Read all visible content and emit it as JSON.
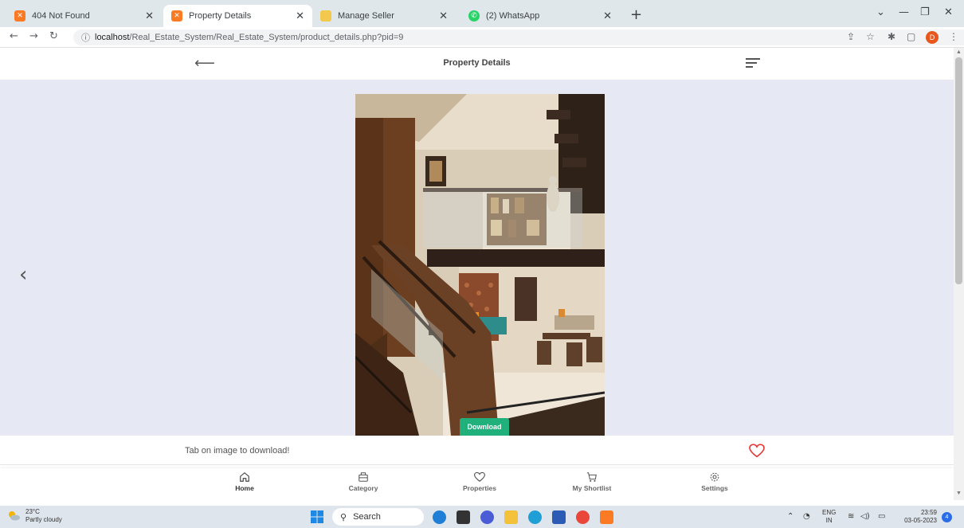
{
  "browser": {
    "tabs": [
      {
        "label": "404 Not Found",
        "icon": "xampp-icon",
        "active": false
      },
      {
        "label": "Property Details",
        "icon": "xampp-icon",
        "active": true
      },
      {
        "label": "Manage Seller",
        "icon": "folder-icon",
        "active": false
      },
      {
        "label": "(2) WhatsApp",
        "icon": "whatsapp-icon",
        "active": false
      }
    ],
    "url_host": "localhost",
    "url_path": "/Real_Estate_System/Real_Estate_System/product_details.php?pid=9",
    "profile_initial": "D"
  },
  "app": {
    "title": "Property Details",
    "download_label": "Download",
    "tap_hint": "Tab on image to download!",
    "nav": [
      {
        "label": "Home",
        "icon": "home-icon",
        "active": true
      },
      {
        "label": "Category",
        "icon": "category-icon",
        "active": false
      },
      {
        "label": "Properties",
        "icon": "heart-icon",
        "active": false
      },
      {
        "label": "My Shortlist",
        "icon": "cart-icon",
        "active": false
      },
      {
        "label": "Settings",
        "icon": "gear-icon",
        "active": false
      }
    ],
    "accent_color": "#20b07c",
    "heart_color": "#e53935"
  },
  "taskbar": {
    "weather_temp": "23°C",
    "weather_desc": "Partly cloudy",
    "search_placeholder": "Search",
    "lang_top": "ENG",
    "lang_bottom": "IN",
    "time": "23:59",
    "date": "03-05-2023",
    "notification_count": "4"
  }
}
